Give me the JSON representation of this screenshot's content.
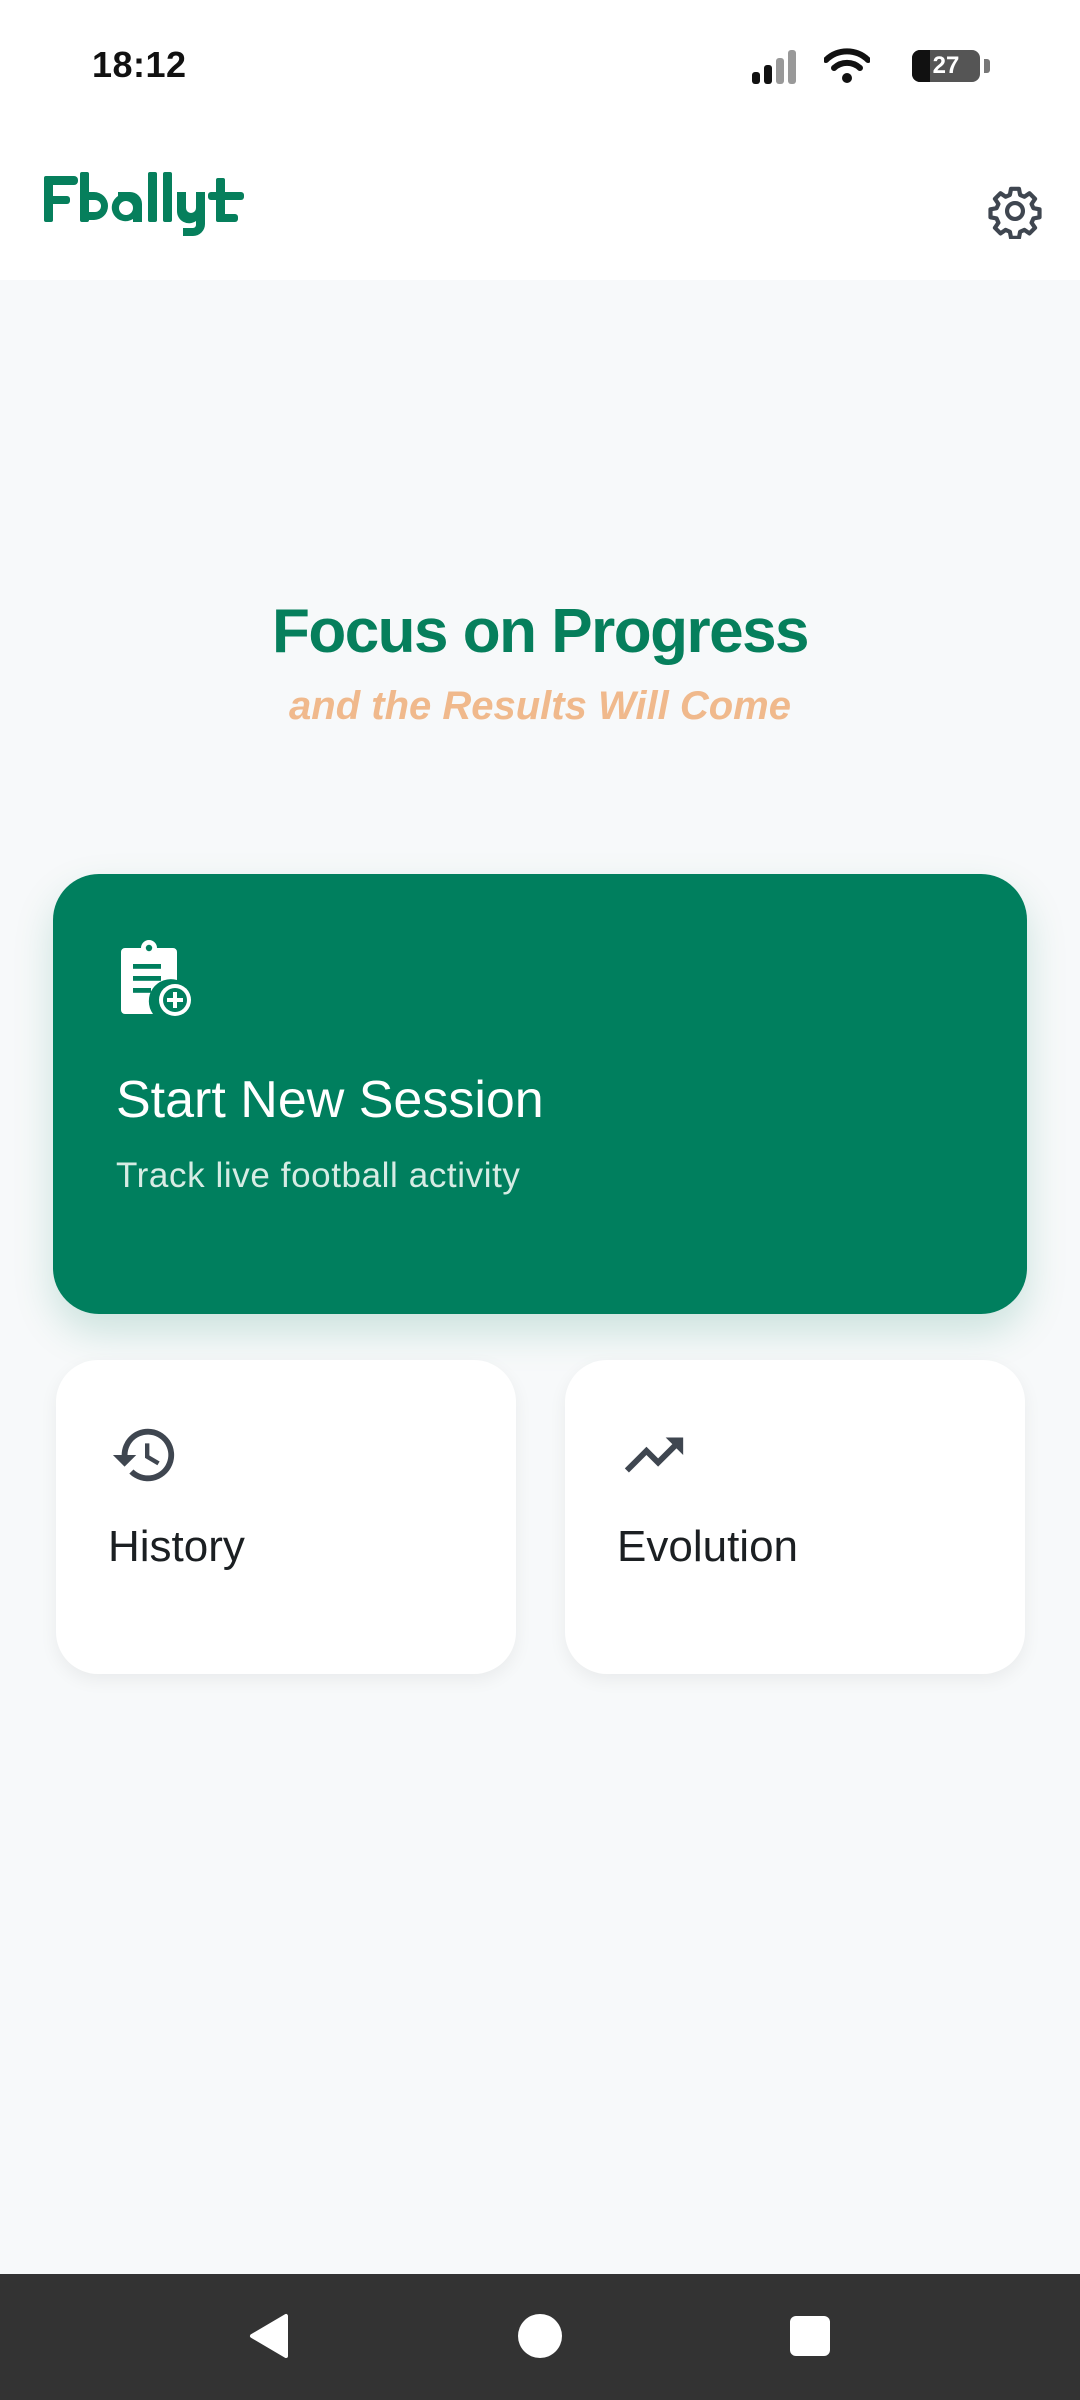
{
  "status_bar": {
    "time": "18:12",
    "battery_level": "27",
    "battery_fraction": 0.27
  },
  "header": {
    "logo_text": "Fballyt",
    "settings_icon": "gear-icon"
  },
  "tagline": {
    "title": "Focus on Progress",
    "subtitle": "and the Results Will Come"
  },
  "start_session": {
    "icon": "clipboard-add-icon",
    "title": "Start New Session",
    "subtitle": "Track live football activity"
  },
  "tiles": [
    {
      "label": "History",
      "icon": "history-icon"
    },
    {
      "label": "Evolution",
      "icon": "trending-up-icon"
    }
  ],
  "colors": {
    "brand_green": "#007f5e",
    "accent_orange": "#f0b98c",
    "background": "#f7f9fa",
    "nav_bar": "#333333"
  }
}
